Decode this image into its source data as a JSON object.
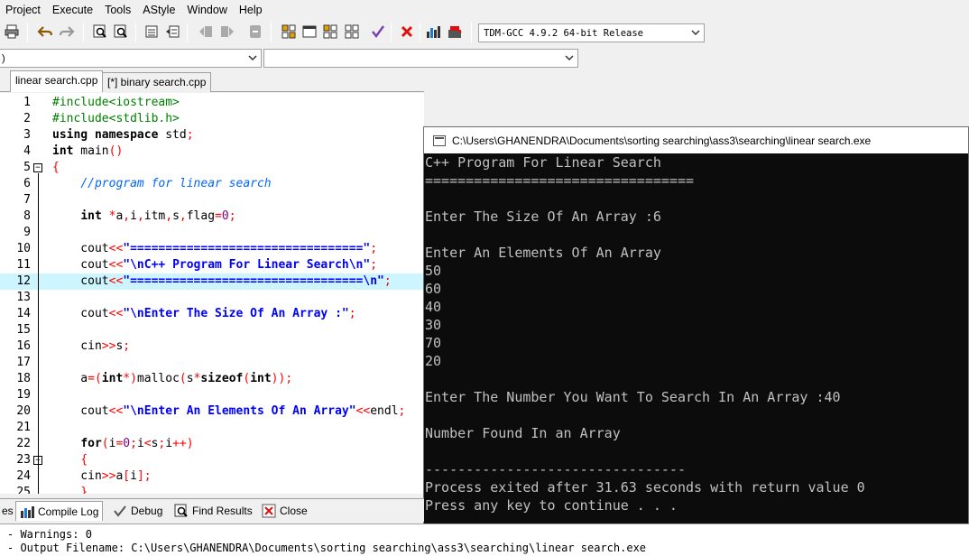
{
  "menu": [
    "Project",
    "Execute",
    "Tools",
    "AStyle",
    "Window",
    "Help"
  ],
  "toolbar": {
    "icons": [
      "print-icon",
      "undo-icon",
      "redo-icon",
      "find-icon",
      "replace-icon",
      "indent-icon",
      "unindent-icon",
      "bookmark-icon",
      "bookmark-next-icon",
      "toggle-comment-icon",
      "compile-icon",
      "run-icon",
      "compile-run-icon",
      "rebuild-icon",
      "syntax-check-icon",
      "stop-icon",
      "chart-icon",
      "debug-icon"
    ],
    "compiler": "TDM-GCC 4.9.2 64-bit Release"
  },
  "class_browser": {
    "scope_value": ")",
    "member_value": ""
  },
  "editor_tabs": [
    "linear search.cpp",
    "[*] binary search.cpp"
  ],
  "code": [
    {
      "n": "1",
      "html": "<span class=\"pp\">#include&lt;iostream&gt;</span>"
    },
    {
      "n": "2",
      "html": "<span class=\"pp\">#include&lt;stdlib.h&gt;</span>"
    },
    {
      "n": "3",
      "html": "<span class=\"kw\">using namespace</span> std<span class=\"op\">;</span>"
    },
    {
      "n": "4",
      "html": "<span class=\"kw\">int</span> main<span class=\"op\">()</span>"
    },
    {
      "n": "5",
      "html": "<span class=\"op\">{</span>"
    },
    {
      "n": "6",
      "html": "    <span class=\"cm\">//program for linear search</span>"
    },
    {
      "n": "7",
      "html": ""
    },
    {
      "n": "8",
      "html": "    <span class=\"kw\">int</span> <span class=\"op\">*</span>a<span class=\"op\">,</span>i<span class=\"op\">,</span>itm<span class=\"op\">,</span>s<span class=\"op\">,</span>flag<span class=\"op\">=</span><span class=\"nm\">0</span><span class=\"op\">;</span>"
    },
    {
      "n": "9",
      "html": ""
    },
    {
      "n": "10",
      "html": "    cout<span class=\"op\">&lt;&lt;</span><span class=\"st\">\"=================================\"</span><span class=\"op\">;</span>"
    },
    {
      "n": "11",
      "html": "    cout<span class=\"op\">&lt;&lt;</span><span class=\"st\">\"\\nC++ Program For Linear Search\\n\"</span><span class=\"op\">;</span>"
    },
    {
      "n": "12",
      "html": "    cout<span class=\"op\">&lt;&lt;</span><span class=\"st\">\"=================================\\n\"</span><span class=\"op\">;</span>"
    },
    {
      "n": "13",
      "html": ""
    },
    {
      "n": "14",
      "html": "    cout<span class=\"op\">&lt;&lt;</span><span class=\"st\">\"\\nEnter The Size Of An Array :\"</span><span class=\"op\">;</span>"
    },
    {
      "n": "15",
      "html": ""
    },
    {
      "n": "16",
      "html": "    cin<span class=\"op\">&gt;&gt;</span>s<span class=\"op\">;</span>"
    },
    {
      "n": "17",
      "html": ""
    },
    {
      "n": "18",
      "html": "    a<span class=\"op\">=(</span><span class=\"kw\">int</span><span class=\"op\">*)</span>malloc<span class=\"op\">(</span>s<span class=\"op\">*</span><span class=\"kw\">sizeof</span><span class=\"op\">(</span><span class=\"kw\">int</span><span class=\"op\">));</span>"
    },
    {
      "n": "19",
      "html": ""
    },
    {
      "n": "20",
      "html": "    cout<span class=\"op\">&lt;&lt;</span><span class=\"st\">\"\\nEnter An Elements Of An Array\"</span><span class=\"op\">&lt;&lt;</span>endl<span class=\"op\">;</span>"
    },
    {
      "n": "21",
      "html": ""
    },
    {
      "n": "22",
      "html": "    <span class=\"kw\">for</span><span class=\"op\">(</span>i<span class=\"op\">=</span><span class=\"nm\">0</span><span class=\"op\">;</span>i<span class=\"op\">&lt;</span>s<span class=\"op\">;</span>i<span class=\"op\">++)</span>"
    },
    {
      "n": "23",
      "html": "    <span class=\"op\">{</span>"
    },
    {
      "n": "24",
      "html": "    cin<span class=\"op\">&gt;&gt;</span>a<span class=\"op\">[</span>i<span class=\"op\">];</span>"
    },
    {
      "n": "25",
      "html": "    <span class=\"op\">}</span>"
    }
  ],
  "console": {
    "title": "C:\\Users\\GHANENDRA\\Documents\\sorting searching\\ass3\\searching\\linear search.exe",
    "lines": [
      "C++ Program For Linear Search",
      "=================================",
      "",
      "Enter The Size Of An Array :6",
      "",
      "Enter An Elements Of An Array",
      "50",
      "60",
      "40",
      "30",
      "70",
      "20",
      "",
      "Enter The Number You Want To Search In An Array :40",
      "",
      "Number Found In an Array",
      "",
      "--------------------------------",
      "Process exited after 31.63 seconds with return value 0",
      "Press any key to continue . . ."
    ]
  },
  "bottom_tabs": {
    "partial": "es",
    "compile_log": "Compile Log",
    "debug": "Debug",
    "find_results": "Find Results",
    "close": "Close"
  },
  "log": [
    "- Warnings: 0",
    "- Output Filename: C:\\Users\\GHANENDRA\\Documents\\sorting searching\\ass3\\searching\\linear search.exe"
  ]
}
